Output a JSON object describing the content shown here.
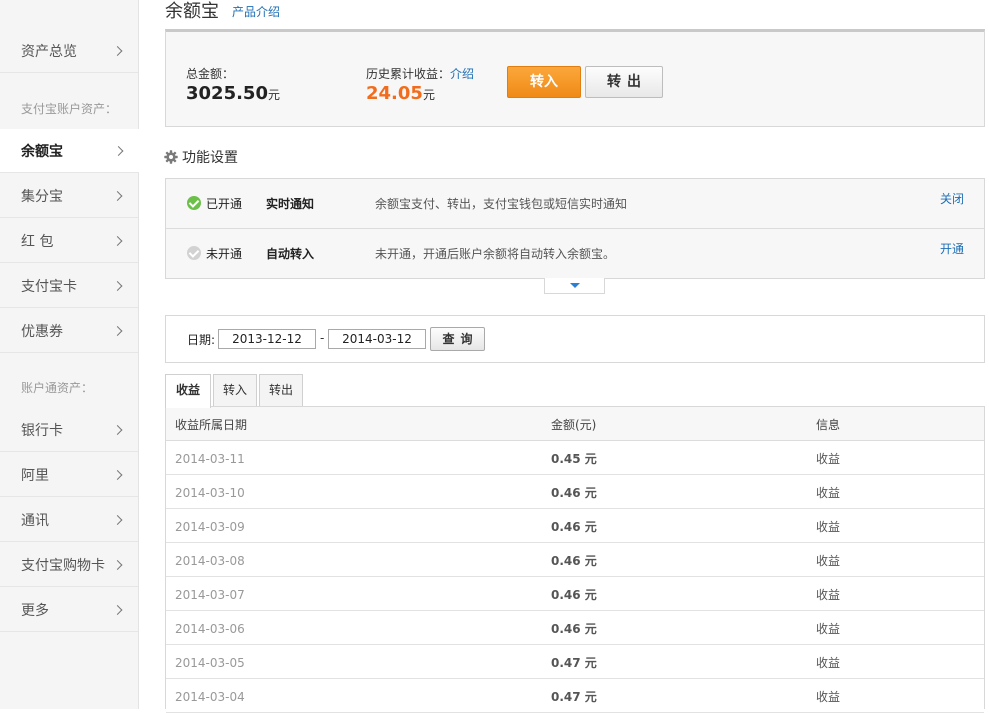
{
  "sidebar": {
    "top_item": "资产总览",
    "section1_title": "支付宝账户资产：",
    "section1_items": [
      "余额宝",
      "集分宝",
      "红 包",
      "支付宝卡",
      "优惠券"
    ],
    "active_item": "余额宝",
    "section2_title": "账户通资产：",
    "section2_items": [
      "银行卡",
      "阿里",
      "通讯",
      "支付宝购物卡",
      "更多"
    ]
  },
  "header": {
    "title": "余额宝",
    "product_link": "产品介绍"
  },
  "summary": {
    "total_label": "总金额：",
    "total_value": "3025.50",
    "total_unit": "元",
    "earnings_label": "历史累计收益：",
    "earnings_intro": "介绍",
    "earnings_value": "24.05",
    "earnings_unit": "元",
    "transfer_in_label": "转入",
    "transfer_out_label": "转出"
  },
  "functions": {
    "title": "功能设置",
    "rows": [
      {
        "status": "已开通",
        "enabled": true,
        "name": "实时通知",
        "description": "余额宝支付、转出，支付宝钱包或短信实时通知",
        "action": "关闭"
      },
      {
        "status": "未开通",
        "enabled": false,
        "name": "自动转入",
        "description": "未开通，开通后账户余额将自动转入余额宝。",
        "action": "开通"
      }
    ]
  },
  "filter": {
    "date_label": "日期:",
    "start_date": "2013-12-12",
    "separator": "-",
    "end_date": "2014-03-12",
    "query_label": "查询"
  },
  "tabs": [
    "收益",
    "转入",
    "转出"
  ],
  "active_tab": "收益",
  "table": {
    "headers": [
      "收益所属日期",
      "金额(元)",
      "信息"
    ],
    "rows": [
      {
        "date": "2014-03-11",
        "amount": "0.45 元",
        "info": "收益"
      },
      {
        "date": "2014-03-10",
        "amount": "0.46 元",
        "info": "收益"
      },
      {
        "date": "2014-03-09",
        "amount": "0.46 元",
        "info": "收益"
      },
      {
        "date": "2014-03-08",
        "amount": "0.46 元",
        "info": "收益"
      },
      {
        "date": "2014-03-07",
        "amount": "0.46 元",
        "info": "收益"
      },
      {
        "date": "2014-03-06",
        "amount": "0.46 元",
        "info": "收益"
      },
      {
        "date": "2014-03-05",
        "amount": "0.47 元",
        "info": "收益"
      },
      {
        "date": "2014-03-04",
        "amount": "0.47 元",
        "info": "收益"
      }
    ]
  },
  "colors": {
    "accent_orange": "#f08a17",
    "earnings_orange": "#f26c1d",
    "link_blue": "#1f6fb5",
    "enabled_green": "#6cc04a"
  },
  "icons": {
    "sidebar_chevron": "chevron-right-icon",
    "settings": "gear-icon",
    "enabled_status": "check-circle-icon",
    "disabled_status": "check-circle-gray-icon",
    "expand": "caret-down-icon"
  }
}
